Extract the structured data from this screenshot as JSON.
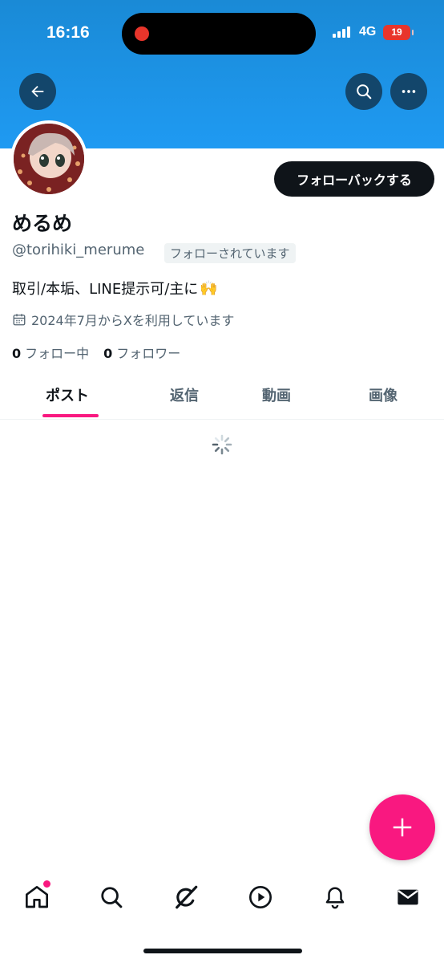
{
  "status_bar": {
    "time": "16:16",
    "network": "4G",
    "battery": "19"
  },
  "header": {
    "back_icon": "arrow-left-icon",
    "search_icon": "search-icon",
    "more_icon": "more-icon"
  },
  "profile": {
    "name": "めるめ",
    "handle": "@torihiki_merume",
    "follows_you_badge": "フォローされています",
    "follow_back_label": "フォローバックする",
    "bio": "取引/本垢、LINE提示可/主に",
    "bio_emoji": "🙌",
    "joined": "2024年7月からXを利用しています",
    "following_count": "0",
    "following_label": "フォロー中",
    "followers_count": "0",
    "followers_label": "フォロワー"
  },
  "tabs": [
    {
      "label": "ポスト",
      "active": true
    },
    {
      "label": "返信",
      "active": false
    },
    {
      "label": "動画",
      "active": false
    },
    {
      "label": "画像",
      "active": false
    }
  ],
  "fab": {
    "icon": "plus-icon"
  },
  "bottom_nav": [
    {
      "icon": "home-icon",
      "has_badge": true
    },
    {
      "icon": "search-icon"
    },
    {
      "icon": "grok-icon"
    },
    {
      "icon": "play-icon"
    },
    {
      "icon": "bell-icon"
    },
    {
      "icon": "mail-icon"
    }
  ],
  "colors": {
    "accent": "#f91880",
    "banner": "#1d9bf0",
    "text": "#0f1419",
    "muted": "#536471"
  }
}
